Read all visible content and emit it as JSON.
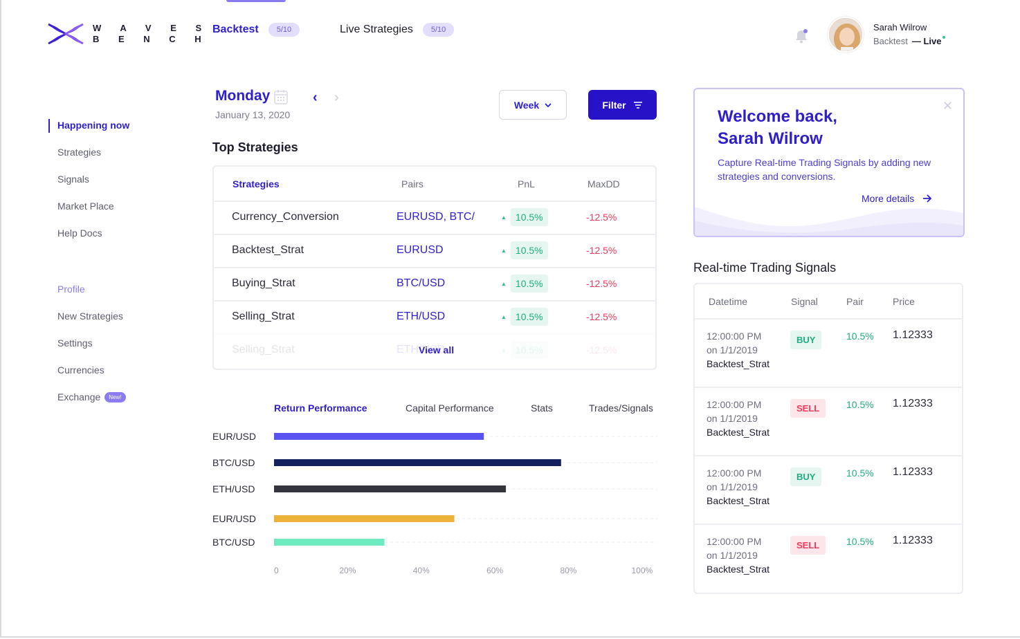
{
  "colors": {
    "accent": "#2d1fc9",
    "positive": "#1fae82",
    "negative": "#ee3a5a",
    "light_accent": "#8a7cf0"
  },
  "brand": {
    "logo_line1": "W A V E S",
    "logo_line2": "B E N C H"
  },
  "top_tabs": [
    {
      "label": "Backtest",
      "count": "5/10"
    },
    {
      "label": "Live Strategies",
      "count": "5/10"
    }
  ],
  "user": {
    "name": "Sarah Wilrow",
    "mode": "Backtest",
    "status": "— Live"
  },
  "sidebar": {
    "items": [
      "Happening now",
      "Strategies",
      "Signals",
      "Market Place",
      "Help Docs"
    ],
    "profile_heading": "Profile",
    "profile_items": [
      "New Strategies",
      "Settings",
      "Currencies",
      "Exchange"
    ],
    "new_badge": "New!"
  },
  "date": {
    "day": "Monday",
    "full": "January 13, 2020"
  },
  "controls": {
    "week": "Week",
    "filter": "Filter"
  },
  "top_strategies": {
    "title": "Top Strategies",
    "headers": [
      "Strategies",
      "Pairs",
      "PnL",
      "MaxDD"
    ],
    "rows": [
      {
        "name": "Currency_Conversion",
        "pair": "EURUSD, BTC/",
        "pnl": "10.5%",
        "maxdd": "-12.5%"
      },
      {
        "name": "Backtest_Strat",
        "pair": "EURUSD",
        "pnl": "10.5%",
        "maxdd": "-12.5%"
      },
      {
        "name": "Buying_Strat",
        "pair": "BTC/USD",
        "pnl": "10.5%",
        "maxdd": "-12.5%"
      },
      {
        "name": "Selling_Strat",
        "pair": "ETH/USD",
        "pnl": "10.5%",
        "maxdd": "-12.5%"
      },
      {
        "name": "Selling_Strat",
        "pair": "ETH/USD",
        "pnl": "10.5%",
        "maxdd": "-12.5%"
      }
    ],
    "view_all": "View all"
  },
  "chart_tabs": [
    "Return Performance",
    "Capital Performance",
    "Stats",
    "Trades/Signals"
  ],
  "chart_data": {
    "type": "bar",
    "orientation": "horizontal",
    "categories": [
      "EUR/USD",
      "BTC/USD",
      "ETH/USD",
      "EUR/USD",
      "BTC/USD"
    ],
    "values": [
      57,
      78,
      63,
      49,
      30
    ],
    "bar_colors": [
      "#5a52f0",
      "#13215e",
      "#34343c",
      "#ecb23a",
      "#6fe9be"
    ],
    "x_ticks": [
      "0",
      "20%",
      "40%",
      "60%",
      "80%",
      "100%"
    ],
    "xlim": [
      0,
      100
    ],
    "grid": true
  },
  "welcome": {
    "title_line1": "Welcome back,",
    "title_line2": "Sarah Wilrow",
    "description": "Capture Real-time Trading Signals by adding new strategies and  conversions.",
    "more": "More details"
  },
  "signals": {
    "title": "Real-time Trading Signals",
    "headers": [
      "Datetime",
      "Signal",
      "Pair",
      "Price"
    ],
    "rows": [
      {
        "time": "12:00:00 PM",
        "date": "on 1/1/2019",
        "strategy": "Backtest_Strat",
        "signal": "BUY",
        "pair": "10.5%",
        "price": "1.12333"
      },
      {
        "time": "12:00:00 PM",
        "date": "on 1/1/2019",
        "strategy": "Backtest_Strat",
        "signal": "SELL",
        "pair": "10.5%",
        "price": "1.12333"
      },
      {
        "time": "12:00:00 PM",
        "date": "on 1/1/2019",
        "strategy": "Backtest_Strat",
        "signal": "BUY",
        "pair": "10.5%",
        "price": "1.12333"
      },
      {
        "time": "12:00:00 PM",
        "date": "on 1/1/2019",
        "strategy": "Backtest_Strat",
        "signal": "SELL",
        "pair": "10.5%",
        "price": "1.12333"
      }
    ]
  }
}
